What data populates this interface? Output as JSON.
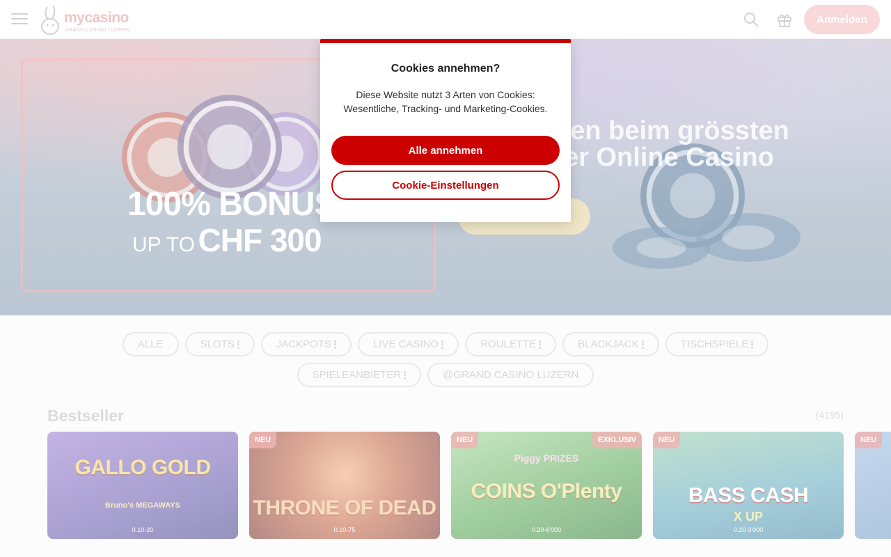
{
  "header": {
    "logo_text": "mycasino",
    "logo_subtitle": "GRAND CASINO LUZERN",
    "login_label": "Anmelden",
    "icons": [
      "menu-icon",
      "search-icon",
      "gift-icon"
    ]
  },
  "hero": {
    "bonus_line1": "100% BONUS",
    "bonus_line2_small": "UP TO",
    "bonus_line2_big": "CHF 300",
    "headline_partial": "nen beim grössten er Online Casino"
  },
  "filters": {
    "row1": [
      {
        "label": "ALLE",
        "has_menu": false
      },
      {
        "label": "SLOTS",
        "has_menu": true
      },
      {
        "label": "JACKPOTS",
        "has_menu": true
      },
      {
        "label": "LIVE CASINO",
        "has_menu": true
      },
      {
        "label": "ROULETTE",
        "has_menu": true
      },
      {
        "label": "BLACKJACK",
        "has_menu": true
      },
      {
        "label": "TISCHSPIELE",
        "has_menu": true
      }
    ],
    "row2": [
      {
        "label": "SPIELEANBIETER",
        "has_menu": true
      },
      {
        "label": "@GRAND CASINO LUZERN",
        "has_menu": false
      }
    ]
  },
  "bestseller": {
    "title": "Bestseller",
    "count": "(4195)",
    "games": [
      {
        "title": "GALLO GOLD",
        "subtitle": "Bruno's MEGAWAYS",
        "range": "0.10-20",
        "badge_left": "",
        "badge_right": ""
      },
      {
        "title": "THRONE OF DEAD",
        "subtitle": "",
        "range": "0.10-75",
        "badge_left": "NEU",
        "badge_right": ""
      },
      {
        "title": "COINS O'Plenty",
        "subtitle": "Piggy PRIZES",
        "range": "0.20-6'000",
        "badge_left": "NEU",
        "badge_right": "EXKLUSIV"
      },
      {
        "title": "BASS CASH",
        "subtitle": "X UP",
        "range": "0.20-3'000",
        "badge_left": "NEU",
        "badge_right": ""
      },
      {
        "title": "",
        "subtitle": "",
        "range": "",
        "badge_left": "NEU",
        "badge_right": ""
      }
    ]
  },
  "cookie_modal": {
    "title": "Cookies annehmen?",
    "text": "Diese Website nutzt 3 Arten von Cookies: Wesentliche, Tracking- und Marketing-Cookies.",
    "accept_label": "Alle annehmen",
    "settings_label": "Cookie-Einstellungen",
    "accent_color": "#cc0000"
  }
}
